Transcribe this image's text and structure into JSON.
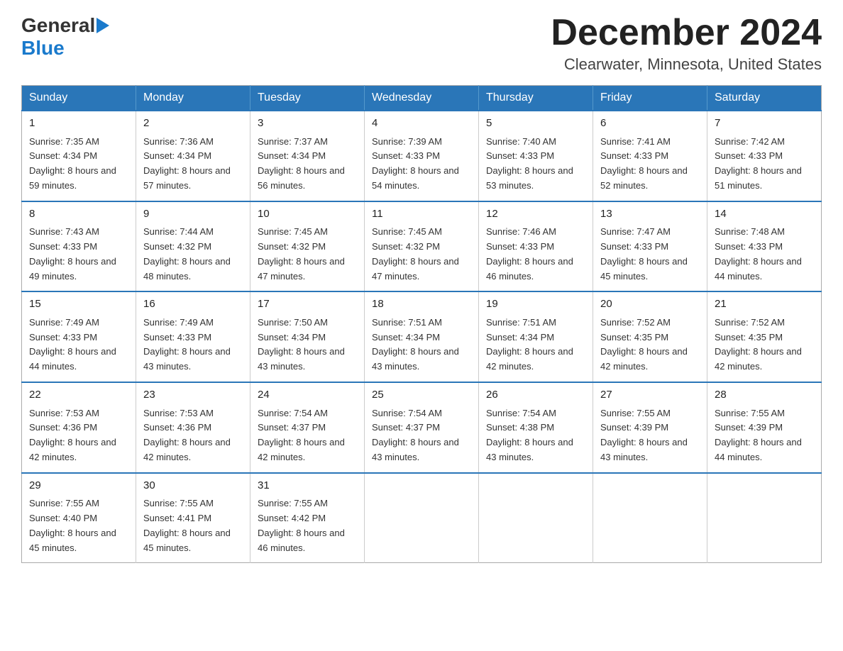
{
  "header": {
    "logo_general": "General",
    "logo_blue": "Blue",
    "month_year": "December 2024",
    "location": "Clearwater, Minnesota, United States"
  },
  "days_of_week": [
    "Sunday",
    "Monday",
    "Tuesday",
    "Wednesday",
    "Thursday",
    "Friday",
    "Saturday"
  ],
  "weeks": [
    [
      {
        "day": "1",
        "sunrise": "7:35 AM",
        "sunset": "4:34 PM",
        "daylight": "8 hours and 59 minutes."
      },
      {
        "day": "2",
        "sunrise": "7:36 AM",
        "sunset": "4:34 PM",
        "daylight": "8 hours and 57 minutes."
      },
      {
        "day": "3",
        "sunrise": "7:37 AM",
        "sunset": "4:34 PM",
        "daylight": "8 hours and 56 minutes."
      },
      {
        "day": "4",
        "sunrise": "7:39 AM",
        "sunset": "4:33 PM",
        "daylight": "8 hours and 54 minutes."
      },
      {
        "day": "5",
        "sunrise": "7:40 AM",
        "sunset": "4:33 PM",
        "daylight": "8 hours and 53 minutes."
      },
      {
        "day": "6",
        "sunrise": "7:41 AM",
        "sunset": "4:33 PM",
        "daylight": "8 hours and 52 minutes."
      },
      {
        "day": "7",
        "sunrise": "7:42 AM",
        "sunset": "4:33 PM",
        "daylight": "8 hours and 51 minutes."
      }
    ],
    [
      {
        "day": "8",
        "sunrise": "7:43 AM",
        "sunset": "4:33 PM",
        "daylight": "8 hours and 49 minutes."
      },
      {
        "day": "9",
        "sunrise": "7:44 AM",
        "sunset": "4:32 PM",
        "daylight": "8 hours and 48 minutes."
      },
      {
        "day": "10",
        "sunrise": "7:45 AM",
        "sunset": "4:32 PM",
        "daylight": "8 hours and 47 minutes."
      },
      {
        "day": "11",
        "sunrise": "7:45 AM",
        "sunset": "4:32 PM",
        "daylight": "8 hours and 47 minutes."
      },
      {
        "day": "12",
        "sunrise": "7:46 AM",
        "sunset": "4:33 PM",
        "daylight": "8 hours and 46 minutes."
      },
      {
        "day": "13",
        "sunrise": "7:47 AM",
        "sunset": "4:33 PM",
        "daylight": "8 hours and 45 minutes."
      },
      {
        "day": "14",
        "sunrise": "7:48 AM",
        "sunset": "4:33 PM",
        "daylight": "8 hours and 44 minutes."
      }
    ],
    [
      {
        "day": "15",
        "sunrise": "7:49 AM",
        "sunset": "4:33 PM",
        "daylight": "8 hours and 44 minutes."
      },
      {
        "day": "16",
        "sunrise": "7:49 AM",
        "sunset": "4:33 PM",
        "daylight": "8 hours and 43 minutes."
      },
      {
        "day": "17",
        "sunrise": "7:50 AM",
        "sunset": "4:34 PM",
        "daylight": "8 hours and 43 minutes."
      },
      {
        "day": "18",
        "sunrise": "7:51 AM",
        "sunset": "4:34 PM",
        "daylight": "8 hours and 43 minutes."
      },
      {
        "day": "19",
        "sunrise": "7:51 AM",
        "sunset": "4:34 PM",
        "daylight": "8 hours and 42 minutes."
      },
      {
        "day": "20",
        "sunrise": "7:52 AM",
        "sunset": "4:35 PM",
        "daylight": "8 hours and 42 minutes."
      },
      {
        "day": "21",
        "sunrise": "7:52 AM",
        "sunset": "4:35 PM",
        "daylight": "8 hours and 42 minutes."
      }
    ],
    [
      {
        "day": "22",
        "sunrise": "7:53 AM",
        "sunset": "4:36 PM",
        "daylight": "8 hours and 42 minutes."
      },
      {
        "day": "23",
        "sunrise": "7:53 AM",
        "sunset": "4:36 PM",
        "daylight": "8 hours and 42 minutes."
      },
      {
        "day": "24",
        "sunrise": "7:54 AM",
        "sunset": "4:37 PM",
        "daylight": "8 hours and 42 minutes."
      },
      {
        "day": "25",
        "sunrise": "7:54 AM",
        "sunset": "4:37 PM",
        "daylight": "8 hours and 43 minutes."
      },
      {
        "day": "26",
        "sunrise": "7:54 AM",
        "sunset": "4:38 PM",
        "daylight": "8 hours and 43 minutes."
      },
      {
        "day": "27",
        "sunrise": "7:55 AM",
        "sunset": "4:39 PM",
        "daylight": "8 hours and 43 minutes."
      },
      {
        "day": "28",
        "sunrise": "7:55 AM",
        "sunset": "4:39 PM",
        "daylight": "8 hours and 44 minutes."
      }
    ],
    [
      {
        "day": "29",
        "sunrise": "7:55 AM",
        "sunset": "4:40 PM",
        "daylight": "8 hours and 45 minutes."
      },
      {
        "day": "30",
        "sunrise": "7:55 AM",
        "sunset": "4:41 PM",
        "daylight": "8 hours and 45 minutes."
      },
      {
        "day": "31",
        "sunrise": "7:55 AM",
        "sunset": "4:42 PM",
        "daylight": "8 hours and 46 minutes."
      },
      {
        "day": "",
        "sunrise": "",
        "sunset": "",
        "daylight": ""
      },
      {
        "day": "",
        "sunrise": "",
        "sunset": "",
        "daylight": ""
      },
      {
        "day": "",
        "sunrise": "",
        "sunset": "",
        "daylight": ""
      },
      {
        "day": "",
        "sunrise": "",
        "sunset": "",
        "daylight": ""
      }
    ]
  ]
}
